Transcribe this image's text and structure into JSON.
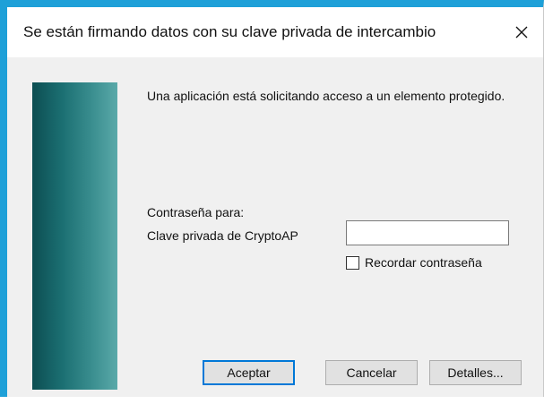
{
  "window": {
    "title": "Se están firmando datos con su clave privada de intercambio",
    "close_glyph": "✕",
    "accent_color": "#1ea0d8"
  },
  "dialog": {
    "message": "Una aplicación está solicitando acceso a un elemento protegido.",
    "password_for_label": "Contraseña para:",
    "key_label": "Clave privada de CryptoAP",
    "password_value": "",
    "remember_label": "Recordar contraseña",
    "remember_checked": false
  },
  "buttons": {
    "accept": "Aceptar",
    "cancel": "Cancelar",
    "details": "Detalles..."
  },
  "icons": {
    "close": "close-icon",
    "checkbox": "checkbox-icon",
    "banner": "teal-banner-graphic"
  }
}
